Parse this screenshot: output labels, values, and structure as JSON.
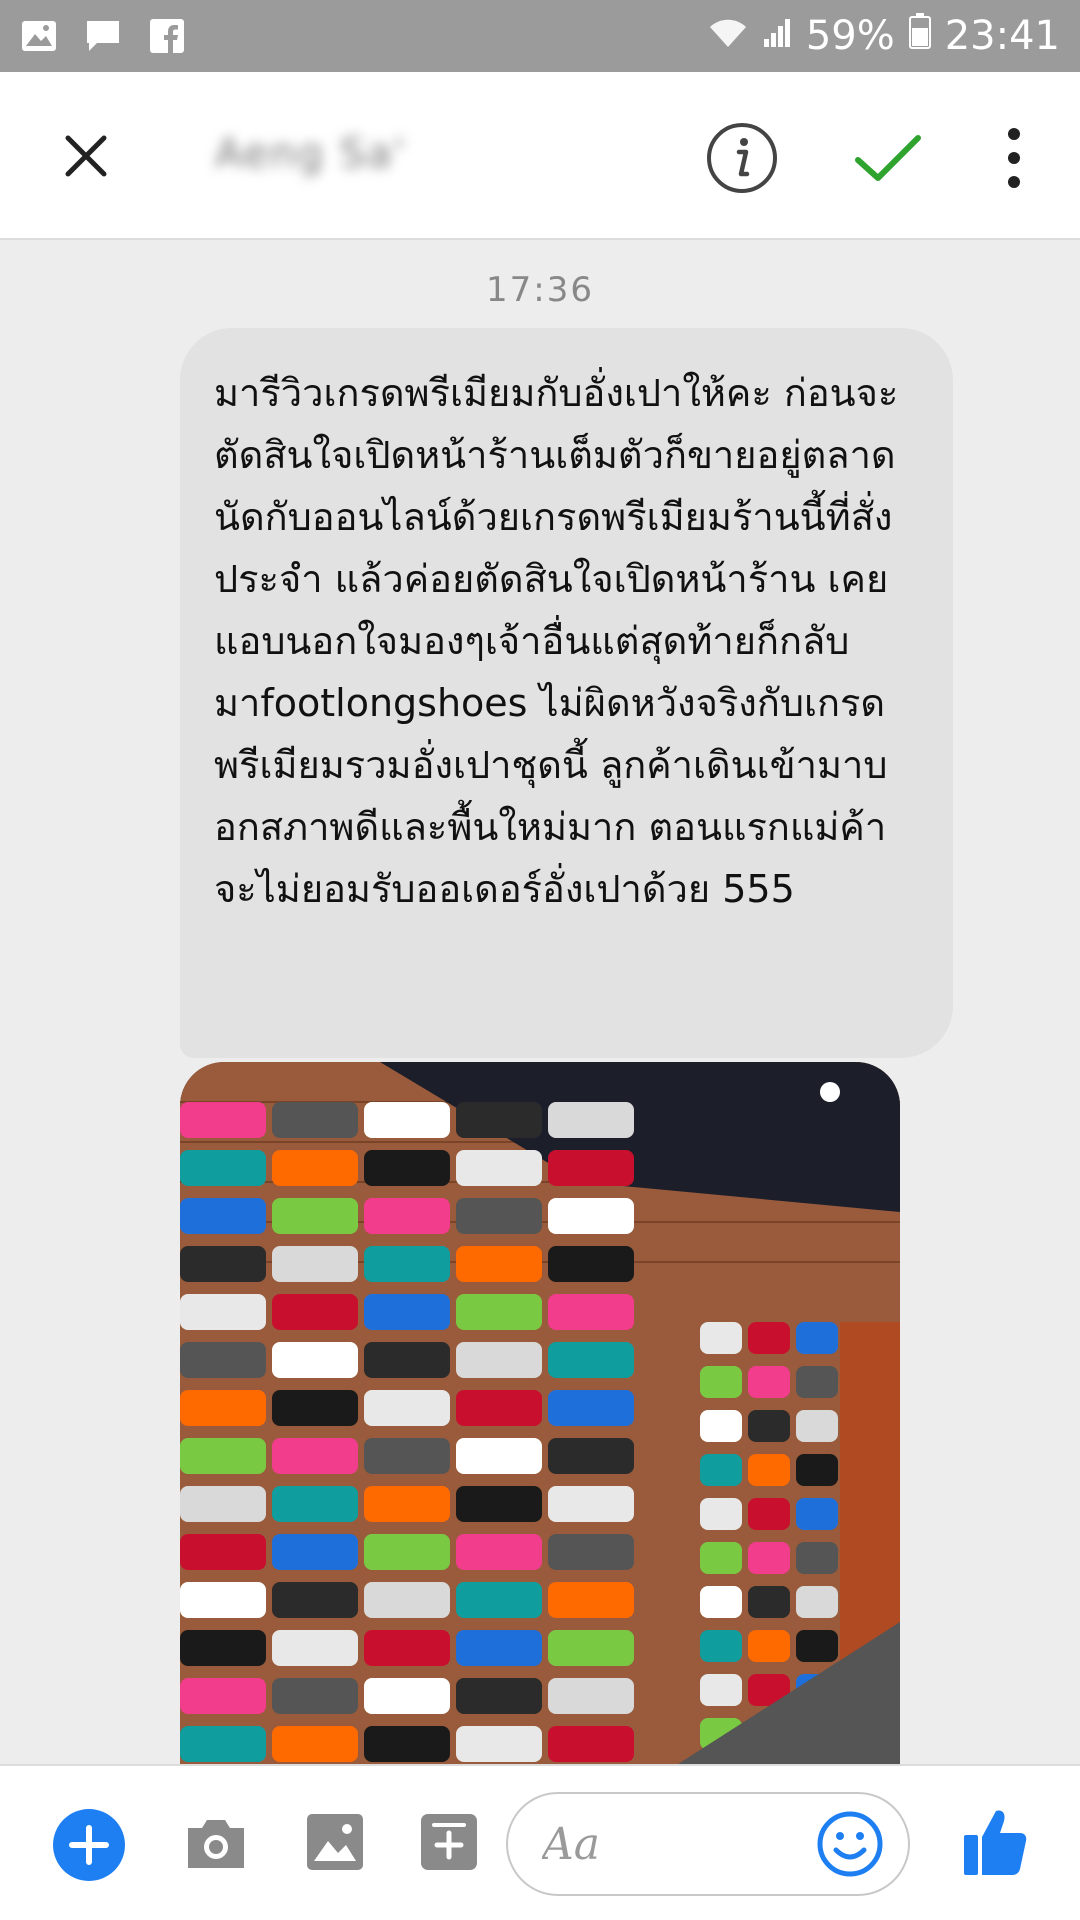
{
  "status_bar": {
    "battery": "59%",
    "time": "23:41",
    "icons": [
      "gallery-icon",
      "chat-bubble-icon",
      "facebook-icon",
      "wifi-icon",
      "signal-icon",
      "battery-icon"
    ]
  },
  "header": {
    "contact_name": "Aeng Sa'",
    "icons": [
      "close-icon",
      "info-icon",
      "check-icon",
      "more-vert-icon"
    ],
    "accent_color": "#2ea32e"
  },
  "conversation": {
    "timestamp": "17:36",
    "message_text": "มารีวิวเกรดพรีเมียมกับอั่งเปาให้คะ ก่อนจะตัดสินใจเปิดหน้าร้านเต็มตัวก็ขายอยู่ตลาดนัดกับออนไลน์ด้วยเกรดพรีเมียมร้านนี้ที่สั่งประจำ แล้วค่อยตัดสินใจเปิดหน้าร้าน เคยแอบนอกใจมองๆเจ้าอื่นแต่สุดท้ายก็กลับมาfootlongshoes ไม่ผิดหวังจริงกับเกรดพรีเมียมรวมอั่งเปาชุดนี้  ลูกค้าเดินเข้ามาบอกสภาพดีและพื้นใหม่มาก ตอนแรกแม่ค้าจะไม่ยอมรับออเดอร์อั่งเปาด้วย 555",
    "photo": "shoe-wall-photo"
  },
  "composer": {
    "placeholder": "Aa",
    "icons": [
      "add-icon",
      "camera-icon",
      "image-icon",
      "sticker-icon",
      "emoji-icon",
      "thumbs-up-icon"
    ],
    "accent_color": "#1e7ff2"
  }
}
